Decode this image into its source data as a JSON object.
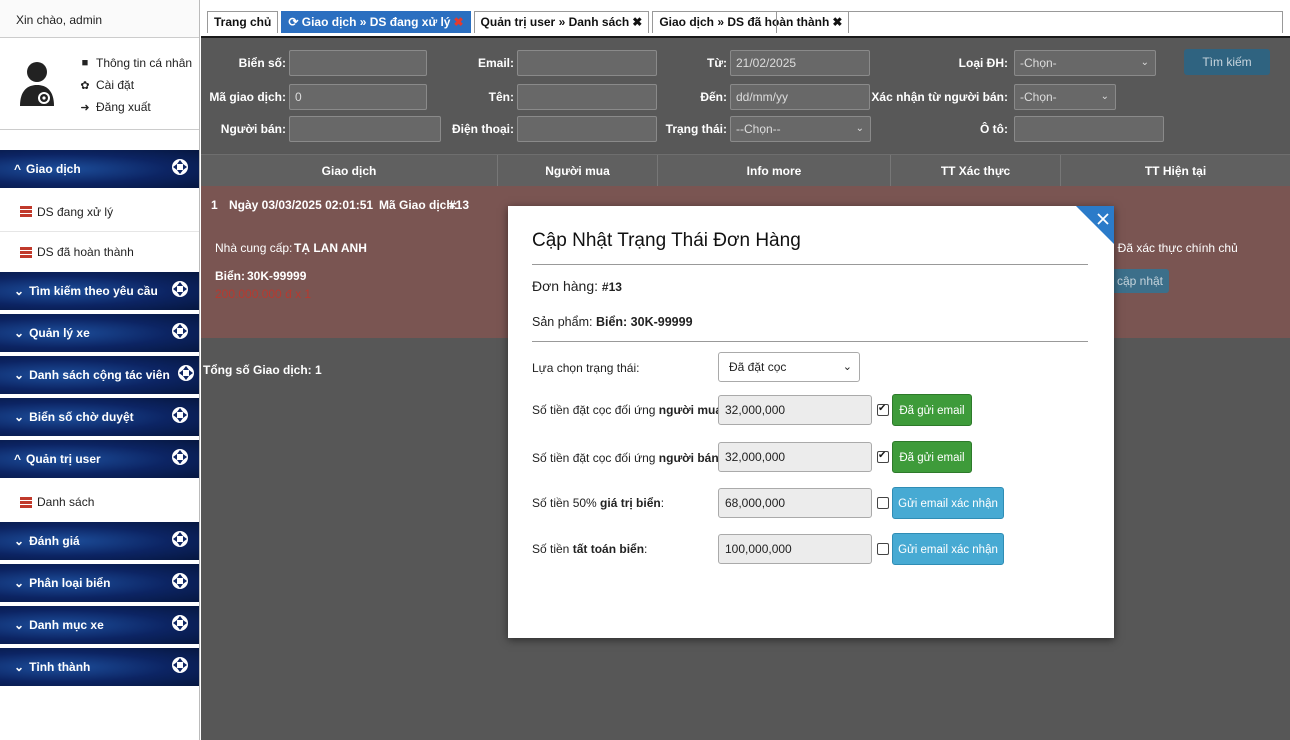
{
  "sidebar": {
    "greeting": "Xin chào, admin",
    "profile_links": [
      {
        "icon": "comment-icon",
        "label": "Thông tin cá nhân"
      },
      {
        "icon": "gear-icon",
        "label": "Cài đặt"
      },
      {
        "icon": "sign-out-icon",
        "label": "Đăng xuất"
      }
    ],
    "sections": [
      {
        "label": "Giao dịch",
        "expanded": true,
        "items": [
          "DS đang xử lý",
          "DS đã hoàn thành"
        ]
      },
      {
        "label": "Tìm kiếm theo yêu cầu",
        "expanded": false
      },
      {
        "label": "Quản lý xe",
        "expanded": false
      },
      {
        "label": "Danh sách cộng tác viên",
        "expanded": false
      },
      {
        "label": "Biển số chờ duyệt",
        "expanded": false
      },
      {
        "label": "Quản trị user",
        "expanded": true,
        "items": [
          "Danh sách"
        ]
      },
      {
        "label": "Đánh giá",
        "expanded": false
      },
      {
        "label": "Phân loại biển",
        "expanded": false
      },
      {
        "label": "Danh mục xe",
        "expanded": false
      },
      {
        "label": "Tỉnh thành",
        "expanded": false
      }
    ]
  },
  "tabs": [
    {
      "label": "Trang chủ",
      "active": false,
      "closable": false
    },
    {
      "label": "Giao dịch » DS đang xử lý",
      "active": true,
      "closable": true
    },
    {
      "label": "Quản trị user » Danh sách",
      "active": false,
      "closable": true
    },
    {
      "label": "Giao dịch » DS đã hoàn thành",
      "active": false,
      "closable": true
    }
  ],
  "filters": {
    "bien_so_label": "Biển số:",
    "bien_so_value": "",
    "ma_gd_label": "Mã giao dịch:",
    "ma_gd_value": "0",
    "nguoi_ban_label": "Người bán:",
    "email_label": "Email:",
    "ten_label": "Tên:",
    "dien_thoai_label": "Điện thoại:",
    "tu_label": "Từ:",
    "tu_value": "21/02/2025",
    "den_label": "Đến:",
    "den_placeholder": "dd/mm/yy",
    "trang_thai_label": "Trạng thái:",
    "trang_thai_value": "--Chọn--",
    "loai_dh_label": "Loại ĐH:",
    "loai_dh_value": "-Chọn-",
    "xac_nhan_label": "Xác nhận từ người bán:",
    "xac_nhan_value": "-Chọn-",
    "oto_label": "Ô tô:",
    "search_button": "Tìm kiếm"
  },
  "table": {
    "headers": [
      "Giao dịch",
      "Người mua",
      "Info more",
      "TT Xác thực",
      "TT Hiện tại"
    ],
    "row": {
      "index": "1",
      "date_text": "Ngày 03/03/2025 02:01:51",
      "ma_gd_label": "Mã Giao dịch:",
      "ma_gd_value": "#13",
      "ncc_label": "Nhà cung cấp:",
      "ncc_value": "TẠ LAN ANH",
      "bien_label": "Biển:",
      "bien_value": "30K-99999",
      "price": "200.000.000 đ x 1",
      "tt_xac_thuc": ": Đã xác thực chính chủ",
      "update_button": "cập nhật"
    },
    "total_label": "Tổng số Giao dịch:",
    "total_value": "1"
  },
  "modal": {
    "title": "Cập Nhật Trạng Thái Đơn Hàng",
    "order_label": "Đơn hàng:",
    "order_value": "#13",
    "product_label": "Sản phẩm:",
    "product_value": "Biển: 30K-99999",
    "status_label": "Lựa chọn trạng thái:",
    "status_value": "Đã đặt cọc",
    "rows": [
      {
        "label_pre": "Số tiền đặt cọc đối ứng ",
        "label_bold": "người mua",
        "label_post": ":",
        "value": "32,000,000",
        "checked": true,
        "button": "Đã gửi email",
        "button_color": "#3e9b3a"
      },
      {
        "label_pre": "Số tiền đặt cọc đối ứng ",
        "label_bold": "người bán",
        "label_post": ":",
        "value": "32,000,000",
        "checked": true,
        "button": "Đã gửi email",
        "button_color": "#3e9b3a"
      },
      {
        "label_pre": "Số tiền 50% ",
        "label_bold": "giá trị biển",
        "label_post": ":",
        "value": "68,000,000",
        "checked": false,
        "button": "Gửi email xác nhận",
        "button_color": "#47aad3"
      },
      {
        "label_pre": "Số tiền ",
        "label_bold": "tất toán biển",
        "label_post": ":",
        "value": "100,000,000",
        "checked": false,
        "button": "Gửi email xác nhận",
        "button_color": "#47aad3"
      }
    ]
  }
}
